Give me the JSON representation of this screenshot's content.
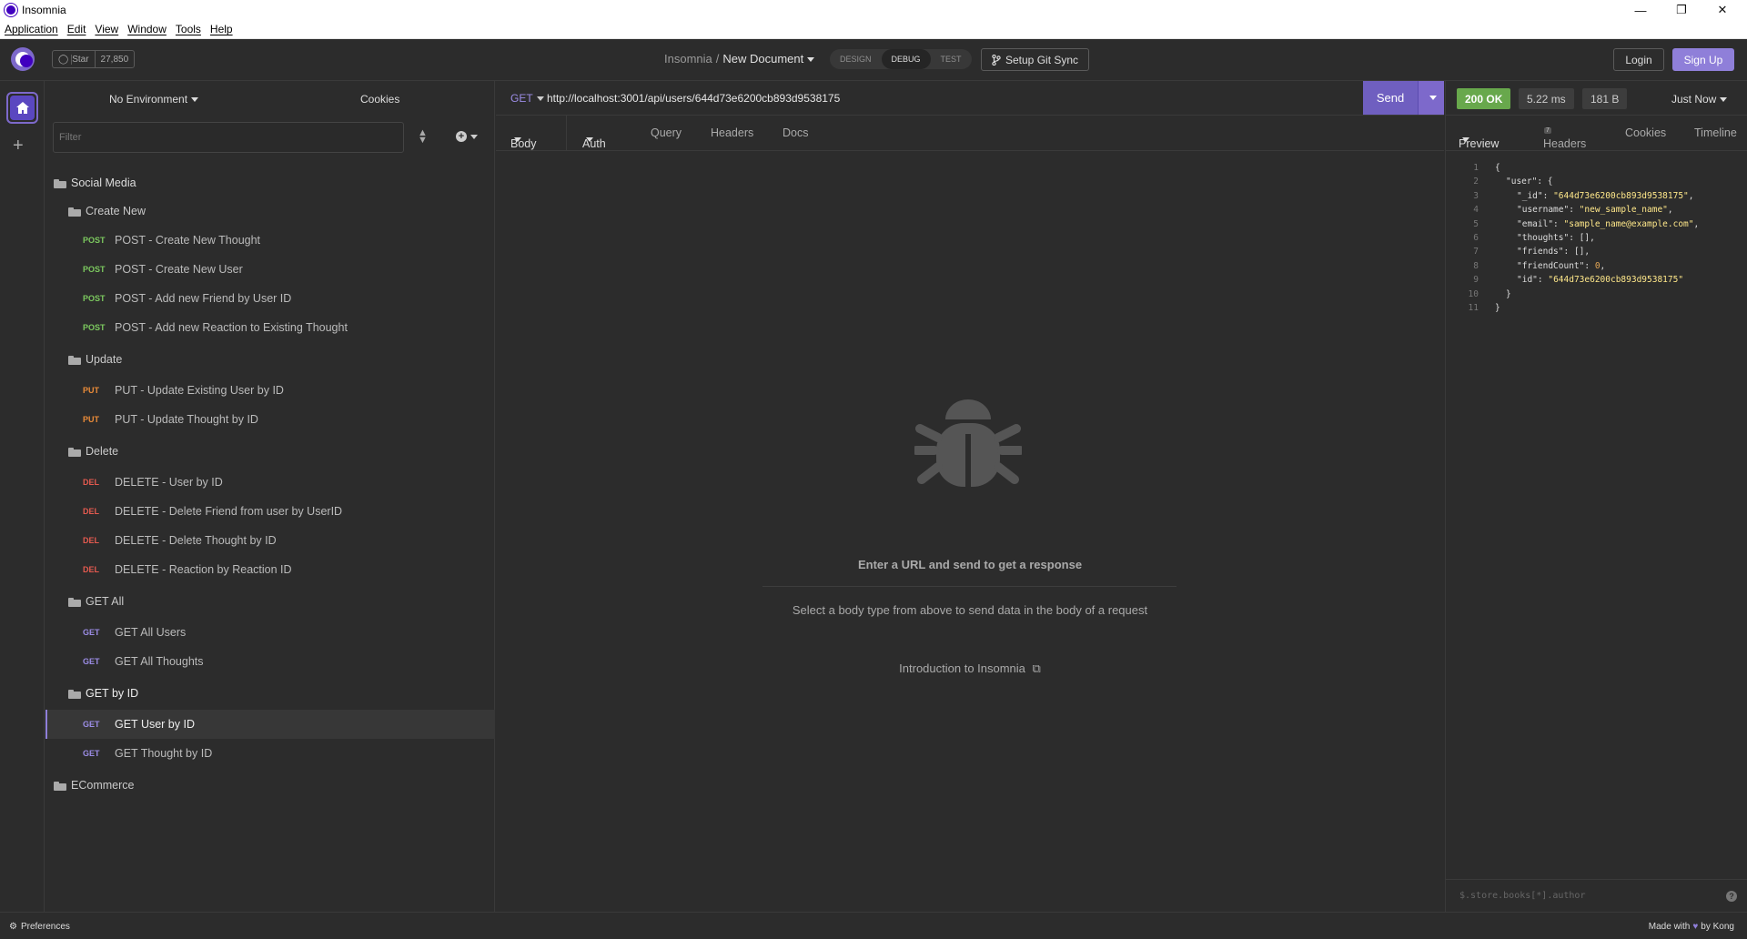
{
  "window": {
    "title": "Insomnia",
    "controls": [
      "minimize",
      "restore",
      "close"
    ]
  },
  "menu": [
    "Application",
    "Edit",
    "View",
    "Window",
    "Tools",
    "Help"
  ],
  "topbar": {
    "github_star_label": "Star",
    "github_star_count": "27,850",
    "breadcrumb_root": "Insomnia",
    "breadcrumb_sep": "/",
    "document_name": "New Document",
    "modes": [
      "DESIGN",
      "DEBUG",
      "TEST"
    ],
    "active_mode": "DEBUG",
    "git_sync_label": "Setup Git Sync",
    "login_label": "Login",
    "signup_label": "Sign Up",
    "accent_color": "#7d69cb"
  },
  "sidebar": {
    "environment": "No Environment",
    "cookies": "Cookies",
    "filter_placeholder": "Filter",
    "workspace": "Social Media",
    "folders": [
      {
        "name": "Create New",
        "requests": [
          {
            "method": "POST",
            "name": "POST - Create New Thought"
          },
          {
            "method": "POST",
            "name": "POST - Create New User"
          },
          {
            "method": "POST",
            "name": "POST - Add new Friend by User ID"
          },
          {
            "method": "POST",
            "name": "POST - Add new Reaction to Existing Thought"
          }
        ]
      },
      {
        "name": "Update",
        "requests": [
          {
            "method": "PUT",
            "name": "PUT - Update Existing User by ID"
          },
          {
            "method": "PUT",
            "name": "PUT - Update Thought by ID"
          }
        ]
      },
      {
        "name": "Delete",
        "requests": [
          {
            "method": "DEL",
            "name": "DELETE - User by ID"
          },
          {
            "method": "DEL",
            "name": "DELETE - Delete Friend from user by UserID"
          },
          {
            "method": "DEL",
            "name": "DELETE - Delete Thought by ID"
          },
          {
            "method": "DEL",
            "name": "DELETE - Reaction by Reaction ID"
          }
        ]
      },
      {
        "name": "GET All",
        "requests": [
          {
            "method": "GET",
            "name": "GET All Users"
          },
          {
            "method": "GET",
            "name": "GET All Thoughts"
          }
        ]
      },
      {
        "name": "GET by ID",
        "requests": [
          {
            "method": "GET",
            "name": "GET User by ID",
            "selected": true
          },
          {
            "method": "GET",
            "name": "GET Thought by ID"
          }
        ]
      }
    ],
    "other_workspace": "ECommerce",
    "method_colors": {
      "POST": "#7cc95f",
      "PUT": "#ea8b39",
      "DEL": "#e45a4f",
      "GET": "#9c8de6"
    }
  },
  "request": {
    "method": "GET",
    "url": "http://localhost:3001/api/users/644d73e6200cb893d9538175",
    "send_label": "Send",
    "tabs": [
      "Body",
      "Auth",
      "Query",
      "Headers",
      "Docs"
    ],
    "empty_title": "Enter a URL and send to get a response",
    "empty_subtitle": "Select a body type from above to send data in the body of a request",
    "intro_link": "Introduction to Insomnia"
  },
  "response": {
    "status": "200 OK",
    "status_color": "#68a84c",
    "time": "5.22 ms",
    "size": "181 B",
    "when": "Just Now",
    "tabs": [
      "Preview",
      "Headers",
      "Cookies",
      "Timeline"
    ],
    "headers_count": "7",
    "line_numbers": [
      "1",
      "2",
      "3",
      "4",
      "5",
      "6",
      "7",
      "8",
      "9",
      "10",
      "11"
    ],
    "body": {
      "l1": "{",
      "l2_key": "\"user\"",
      "l2_rest": ": {",
      "l3_key": "\"_id\"",
      "l3_val": "\"644d73e6200cb893d9538175\"",
      "l4_key": "\"username\"",
      "l4_val": "\"new_sample_name\"",
      "l5_key": "\"email\"",
      "l5_val": "\"sample_name@example.com\"",
      "l6_key": "\"thoughts\"",
      "l6_val": "[]",
      "l7_key": "\"friends\"",
      "l7_val": "[]",
      "l8_key": "\"friendCount\"",
      "l8_val": "0",
      "l9_key": "\"id\"",
      "l9_val": "\"644d73e6200cb893d9538175\"",
      "l10": "}",
      "l11": "}"
    },
    "filter_placeholder": "$.store.books[*].author"
  },
  "statusbar": {
    "preferences": "Preferences",
    "made_with": "Made with",
    "by": "by Kong"
  }
}
